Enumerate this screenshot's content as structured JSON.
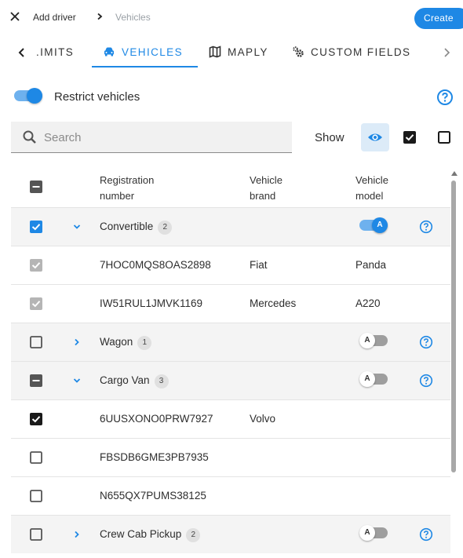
{
  "header": {
    "breadcrumb_main": "Add driver",
    "breadcrumb_sub": "Vehicles",
    "create_label": "Create"
  },
  "tabs": [
    {
      "label": ".IMITS",
      "icon": "none",
      "active": false
    },
    {
      "label": "VEHICLES",
      "icon": "car-icon",
      "active": true
    },
    {
      "label": "MAPLY",
      "icon": "map-icon",
      "active": false
    },
    {
      "label": "CUSTOM FIELDS",
      "icon": "gears-icon",
      "active": false
    }
  ],
  "restrict": {
    "label": "Restrict vehicles",
    "enabled": true
  },
  "search": {
    "placeholder": "Search",
    "value": ""
  },
  "show": {
    "label": "Show"
  },
  "table": {
    "headers": {
      "registration": "Registration number",
      "brand": "Vehicle brand",
      "model": "Vehicle model"
    },
    "rows": [
      {
        "type": "group",
        "name": "Convertible",
        "count": "2",
        "checkbox": "checked-blue",
        "expanded": true,
        "toggle": "on",
        "toggle_label": "A"
      },
      {
        "type": "vehicle",
        "registration": "7HOC0MQS8OAS2898",
        "brand": "Fiat",
        "model": "Panda",
        "checkbox": "checked-disabled"
      },
      {
        "type": "vehicle",
        "registration": "IW51RUL1JMVK1169",
        "brand": "Mercedes",
        "model": "A220",
        "checkbox": "checked-disabled"
      },
      {
        "type": "group",
        "name": "Wagon",
        "count": "1",
        "checkbox": "unchecked",
        "expanded": false,
        "toggle": "off",
        "toggle_label": "A"
      },
      {
        "type": "group",
        "name": "Cargo Van",
        "count": "3",
        "checkbox": "indeterminate",
        "expanded": true,
        "toggle": "off",
        "toggle_label": "A"
      },
      {
        "type": "vehicle",
        "registration": "6UUSXONO0PRW7927",
        "brand": "Volvo",
        "model": "",
        "checkbox": "checked-dark"
      },
      {
        "type": "vehicle",
        "registration": "FBSDB6GME3PB7935",
        "brand": "",
        "model": "",
        "checkbox": "unchecked"
      },
      {
        "type": "vehicle",
        "registration": "N655QX7PUMS38125",
        "brand": "",
        "model": "",
        "checkbox": "unchecked"
      },
      {
        "type": "group",
        "name": "Crew Cab Pickup",
        "count": "2",
        "checkbox": "unchecked",
        "expanded": false,
        "toggle": "off",
        "toggle_label": "A"
      }
    ]
  },
  "colors": {
    "accent": "#1e88e5",
    "accent_light": "#6eb1ee",
    "group_bg": "#f4f4f4"
  }
}
